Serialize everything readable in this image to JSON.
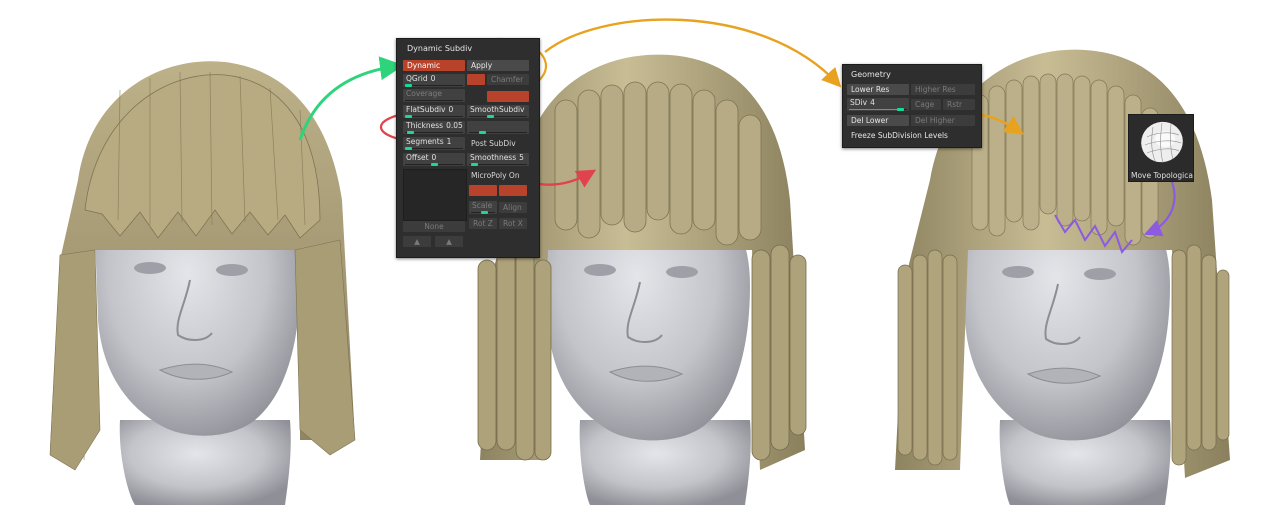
{
  "panel_dynamic": {
    "title": "Dynamic Subdiv",
    "dynamic_btn": "Dynamic",
    "apply_btn": "Apply",
    "qgrid_label": "QGrid",
    "qgrid_value": "0",
    "qgrid_level": 0.05,
    "chamfer_btn": "Chamfer",
    "coverage_label": "Coverage",
    "flatsubdiv_label": "FlatSubdiv",
    "flatsubdiv_value": "0",
    "smoothsubdiv_label": "SmoothSubdiv",
    "thickness_label": "Thickness",
    "thickness_value": "0.05",
    "segments_label": "Segments",
    "segments_value": "1",
    "post_subdiv_label": "Post SubDiv",
    "offset_label": "Offset",
    "offset_value": "0",
    "smoothness_label": "Smoothness",
    "smoothness_value": "5",
    "micropoly_label": "MicroPoly On",
    "scale_label": "Scale",
    "align_label": "Align",
    "rotz_label": "Rot Z",
    "rotx_label": "Rot X",
    "none_label": "None"
  },
  "panel_geometry": {
    "title": "Geometry",
    "lower_res": "Lower Res",
    "higher_res": "Higher Res",
    "sdiv_label": "SDiv",
    "sdiv_value": "4",
    "cage_btn": "Cage",
    "rstr_btn": "Rstr",
    "del_lower": "Del Lower",
    "del_higher": "Del Higher",
    "freeze": "Freeze SubDivision Levels"
  },
  "move_topological": {
    "label": "Move Topologica"
  },
  "colors": {
    "panel_bg": "#2e2e2e",
    "button_red": "#b8432a",
    "slider_knob": "#18d89a",
    "hair": "#b3a57d",
    "skin": "#c9cad0",
    "arrow_green": "#2ed47a",
    "arrow_orange": "#e8a21f",
    "arrow_red": "#e0434d",
    "arrow_purple": "#8d5be0"
  }
}
